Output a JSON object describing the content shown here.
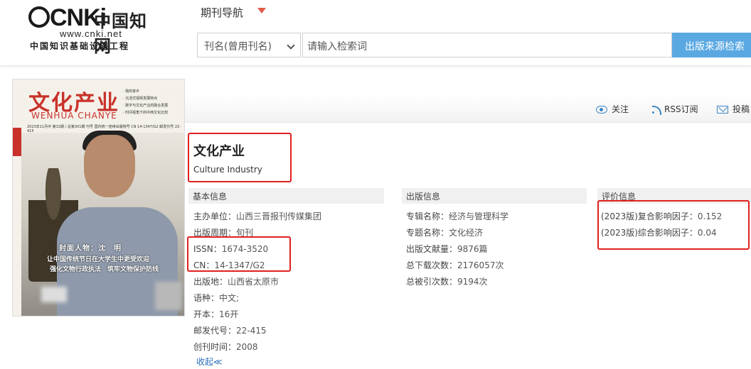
{
  "logo": {
    "latin": "CNKi",
    "chinese": "中国知网",
    "url": "www.cnki.net",
    "subtitle": "中国知识基础设施工程"
  },
  "header": {
    "nav_label": "期刊导航",
    "search_field_value": "刊名(曾用刊名)",
    "search_placeholder": "请输入检索词",
    "search_button": "出版来源检索"
  },
  "cover": {
    "title": "文化产业",
    "pinyin": "WENHUA CHANYE",
    "side_label": "文化产业",
    "bullets": [
      "· 我的家乡",
      "· 沉浸式视频发展特点",
      "· 数字与文化产业的融合发展",
      "· 时间视角下的中西文化比较"
    ],
    "issue_line": "2023年11月中 第32期 / 总第301期  刊号 国内统一连续出版物号 CN 14-1347/G2  邮发代号 22-415",
    "caption_line1": "封面人物：沈　明",
    "caption_line2": "让中国传统节日在大学生中更受欢迎",
    "caption_line3": "强化文物行政执法　筑牢文物保护防线"
  },
  "toolbar": {
    "follow": "关注",
    "rss": "RSS订阅",
    "submit": "投稿"
  },
  "journal": {
    "title": "文化产业",
    "title_en": "Culture Industry"
  },
  "basic_info": {
    "heading": "基本信息",
    "rows": [
      {
        "label": "主办单位：",
        "value": "山西三晋报刊传媒集团"
      },
      {
        "label": "出版周期：",
        "value": "旬刊"
      },
      {
        "label": "ISSN：",
        "value": "1674-3520"
      },
      {
        "label": "CN：",
        "value": "14-1347/G2"
      },
      {
        "label": "出版地：",
        "value": "山西省太原市"
      },
      {
        "label": "语种：",
        "value": "中文;"
      },
      {
        "label": "开本：",
        "value": "16开"
      },
      {
        "label": "邮发代号：",
        "value": "22-415"
      },
      {
        "label": "创刊时间：",
        "value": "2008"
      }
    ],
    "collapse": "收起≪"
  },
  "publish_info": {
    "heading": "出版信息",
    "rows": [
      {
        "label": "专辑名称：",
        "value": "经济与管理科学"
      },
      {
        "label": "专题名称：",
        "value": "文化经济"
      },
      {
        "label": "出版文献量：",
        "value": "9876篇"
      },
      {
        "label": "总下载次数：",
        "value": "2176057次"
      },
      {
        "label": "总被引次数：",
        "value": "9194次"
      }
    ]
  },
  "eval_info": {
    "heading": "评价信息",
    "rows": [
      {
        "label": "(2023版)复合影响因子：",
        "value": "0.152"
      },
      {
        "label": "(2023版)综合影响因子：",
        "value": "0.04"
      }
    ]
  },
  "colors": {
    "accent_blue": "#5aa8e2",
    "highlight_red": "#e02020",
    "cover_red": "#c8322a"
  }
}
